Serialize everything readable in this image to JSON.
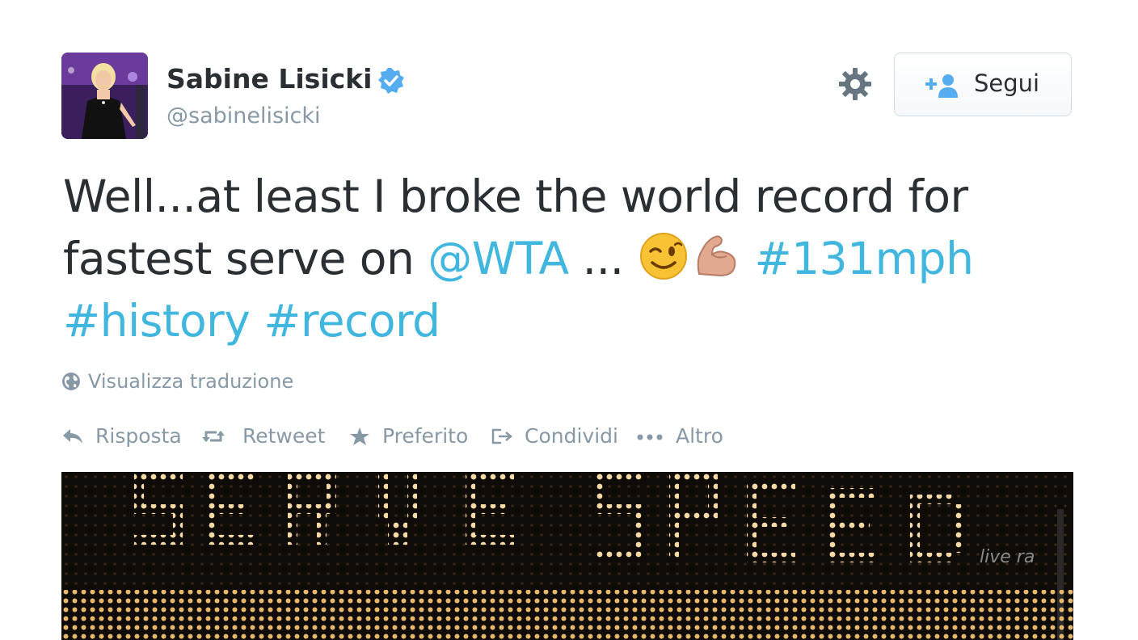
{
  "user": {
    "display_name": "Sabine Lisicki",
    "screen_name": "@sabinelisicki",
    "verified": true
  },
  "header": {
    "follow_label": "Segui",
    "settings_icon": "gear-icon",
    "follow_icon": "add-user-icon"
  },
  "tweet": {
    "line1": "Well...at least I broke the world record for",
    "line2_text": "fastest serve on ",
    "mention": "@WTA",
    "ellipsis": " ... ",
    "emoji1": "winking-face-emoji",
    "emoji2": "flexed-biceps-emoji",
    "hashtag1": "#131mph",
    "hashtag2": "#history",
    "hashtag3": "#record"
  },
  "translate": {
    "label": "Visualizza traduzione",
    "icon": "globe-icon"
  },
  "actions": [
    {
      "label": "Risposta",
      "icon": "reply-icon"
    },
    {
      "label": "Retweet",
      "icon": "retweet-icon"
    },
    {
      "label": "Preferito",
      "icon": "star-icon"
    },
    {
      "label": "Condividi",
      "icon": "share-icon"
    },
    {
      "label": "Altro",
      "icon": "more-icon"
    }
  ],
  "media": {
    "sign_text": "SERVE SPEED",
    "watermark": "live ra"
  },
  "colors": {
    "link": "#41b7e0",
    "muted": "#8899a6",
    "text": "#292f33",
    "verified": "#55acee"
  }
}
